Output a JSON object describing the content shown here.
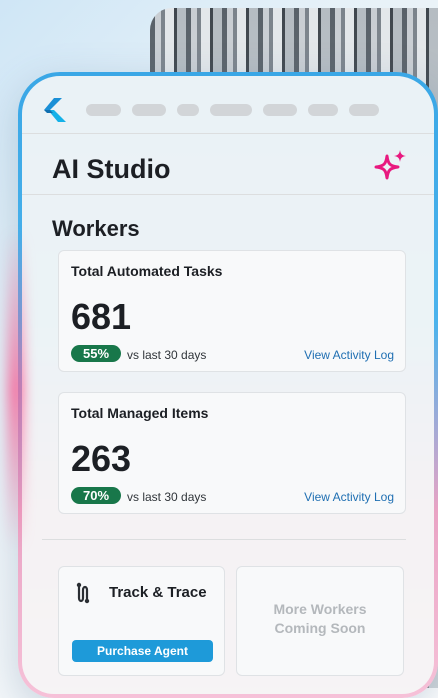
{
  "app": {
    "title": "AI Studio"
  },
  "colors": {
    "accent_blue": "#1e9ad9",
    "badge_green": "#18774a",
    "sparkle_pink": "#e8197f",
    "link_blue": "#1f6fb2"
  },
  "header": {
    "logo_icon": "brand-logo-icon",
    "nav_placeholders": 7,
    "sparkle_icon": "ai-sparkle-icon"
  },
  "workers": {
    "section_title": "Workers",
    "cards": [
      {
        "title": "Total Automated Tasks",
        "value": "681",
        "change": "55%",
        "comparison": "vs last 30 days",
        "link": "View Activity Log"
      },
      {
        "title": "Total Managed Items",
        "value": "263",
        "change": "70%",
        "comparison": "vs last 30 days",
        "link": "View Activity Log"
      }
    ]
  },
  "tiles": {
    "track": {
      "icon": "route-icon",
      "title": "Track & Trace",
      "button": "Purchase Agent"
    },
    "more": {
      "line1": "More Workers",
      "line2": "Coming Soon"
    }
  }
}
